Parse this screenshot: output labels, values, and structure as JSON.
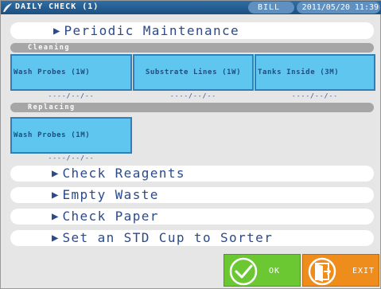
{
  "window": {
    "title": "DAILY CHECK (1)",
    "user": "BILL",
    "datetime": "2011/05/20 11:39"
  },
  "items": {
    "periodic_maintenance": "Periodic Maintenance",
    "check_reagents": "Check Reagents",
    "empty_waste": "Empty Waste",
    "check_paper": "Check Paper",
    "set_std_cup": "Set an STD Cup to Sorter"
  },
  "cleaning": {
    "header": "Cleaning",
    "tasks": [
      {
        "label": "Wash Probes (1W)",
        "date": "----/--/--"
      },
      {
        "label": "Substrate Lines (1W)",
        "date": "----/--/--"
      },
      {
        "label": "Tanks Inside (3M)",
        "date": "----/--/--"
      }
    ]
  },
  "replacing": {
    "header": "Replacing",
    "tasks": [
      {
        "label": "Wash Probes (1M)",
        "date": "----/--/--"
      }
    ]
  },
  "buttons": {
    "ok_label": "OK",
    "exit_label": "EXIT"
  },
  "icons": {
    "title": "app-logo-icon",
    "ok": "check-icon",
    "exit": "exit-door-icon"
  },
  "colors": {
    "titlebar": "#2f6ea6",
    "tile": "#5fc6ef",
    "ok": "#6cc832",
    "exit": "#ee8c1c"
  }
}
